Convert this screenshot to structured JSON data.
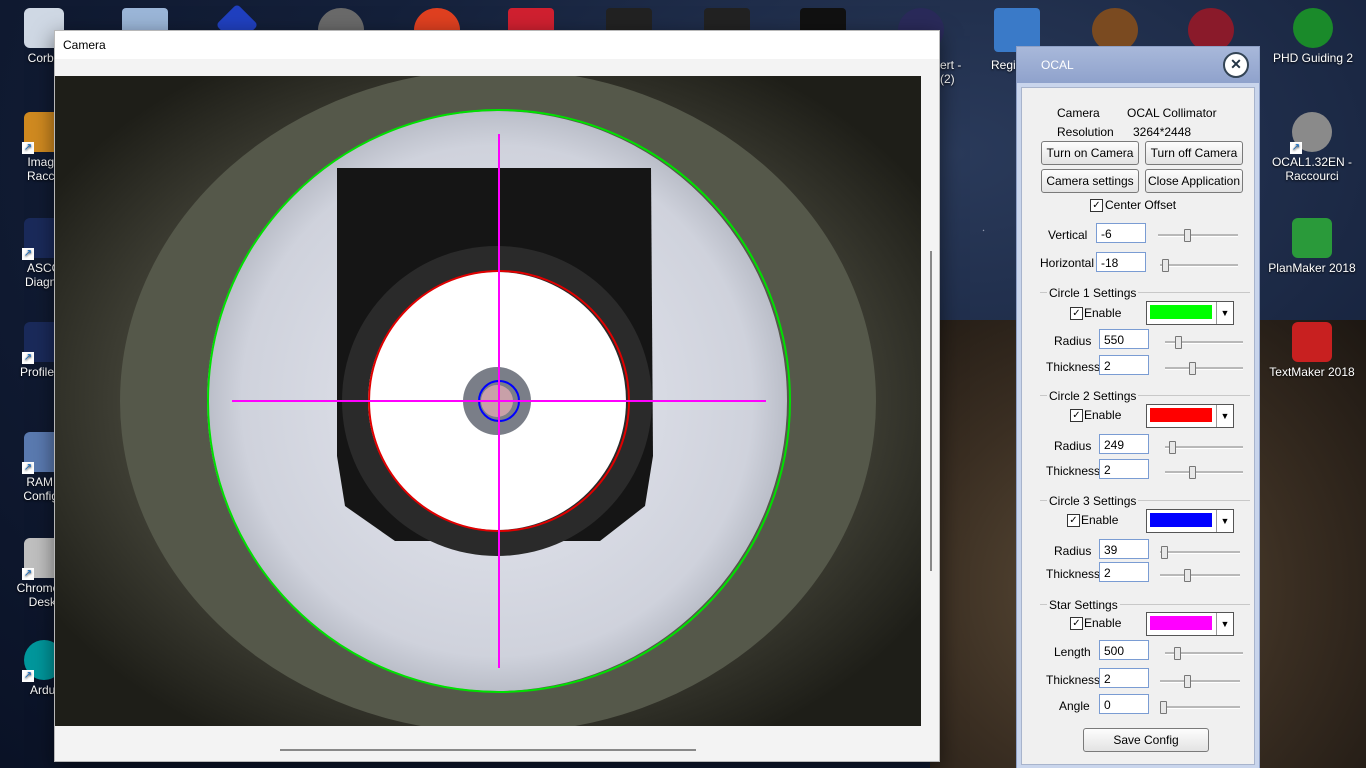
{
  "desktop": {
    "left_icons": [
      {
        "label": "Corbe",
        "name": "recycle-bin"
      },
      {
        "label": "Image\nRacco",
        "name": "image-shortcut"
      },
      {
        "label": "ASCO\nDiagno",
        "name": "ascom-diagnostics"
      },
      {
        "label": "ProfileEx",
        "name": "profile-explorer"
      },
      {
        "label": "RAMD\nConfigu",
        "name": "ramd-config"
      },
      {
        "label": "Chrome R\nDeskt",
        "name": "chrome-remote-desktop"
      },
      {
        "label": "Ardui",
        "name": "arduino"
      }
    ],
    "right_icons": [
      {
        "label": "PHD Guiding 2",
        "name": "phd-guiding"
      },
      {
        "label": "OCAL1.32EN -\nRaccourci",
        "name": "ocal-shortcut"
      },
      {
        "label": "PlanMaker 2018",
        "name": "planmaker"
      },
      {
        "label": "TextMaker 2018",
        "name": "textmaker"
      }
    ],
    "partial_labels": {
      "regi": "Regi",
      "ert": "ert -\n(2)"
    }
  },
  "camera_window": {
    "title": "Camera"
  },
  "overlay": {
    "circle1_color": "#00e000",
    "circle2_color": "#e00000",
    "circle3_color": "#0000ff",
    "star_color": "#ff00ff"
  },
  "ocal": {
    "title": "OCAL",
    "camera_label": "Camera",
    "camera_value": "OCAL Collimator",
    "resolution_label": "Resolution",
    "resolution_value": "3264*2448",
    "buttons": {
      "turn_on": "Turn on Camera",
      "turn_off": "Turn off Camera",
      "settings": "Camera settings",
      "close": "Close Application",
      "save": "Save Config"
    },
    "center_offset": {
      "label": "Center Offset",
      "checked": true
    },
    "vertical": {
      "label": "Vertical",
      "value": "-6",
      "level": 0.35
    },
    "horizontal": {
      "label": "Horizontal",
      "value": "-18",
      "level": 0.03
    },
    "circle1": {
      "title": "Circle 1 Settings",
      "enable": "Enable",
      "radius_label": "Radius",
      "radius": "550",
      "radius_level": 0.14,
      "thickness_label": "Thickness",
      "thickness": "2",
      "thickness_level": 0.33,
      "color": "#00ff00"
    },
    "circle2": {
      "title": "Circle 2 Settings",
      "enable": "Enable",
      "radius_label": "Radius",
      "radius": "249",
      "radius_level": 0.06,
      "thickness_label": "Thickness",
      "thickness": "2",
      "thickness_level": 0.33,
      "color": "#ff0000"
    },
    "circle3": {
      "title": "Circle 3 Settings",
      "enable": "Enable",
      "radius_label": "Radius",
      "radius": "39",
      "radius_level": 0.01,
      "thickness_label": "Thickness",
      "thickness": "2",
      "thickness_level": 0.33,
      "color": "#0000ff"
    },
    "star": {
      "title": "Star Settings",
      "enable": "Enable",
      "length_label": "Length",
      "length": "500",
      "length_level": 0.12,
      "thickness_label": "Thickness",
      "thickness": "2",
      "thickness_level": 0.33,
      "angle_label": "Angle",
      "angle": "0",
      "angle_level": 0.0,
      "color": "#ff00ff"
    }
  }
}
